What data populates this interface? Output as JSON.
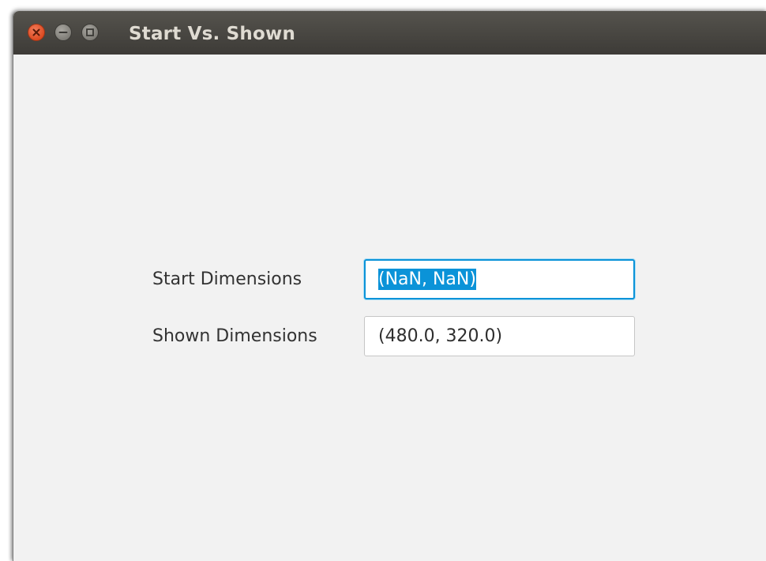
{
  "window": {
    "title": "Start Vs. Shown"
  },
  "form": {
    "rows": [
      {
        "label": "Start Dimensions",
        "value": "(NaN, NaN)",
        "focused": true,
        "selected": true
      },
      {
        "label": "Shown Dimensions",
        "value": "(480.0, 320.0)",
        "focused": false,
        "selected": false
      }
    ]
  },
  "colors": {
    "titlebar": "#3d3b37",
    "window_bg": "#f2f2f2",
    "focus_accent": "#0b93d8",
    "close_button": "#dd4b22"
  }
}
